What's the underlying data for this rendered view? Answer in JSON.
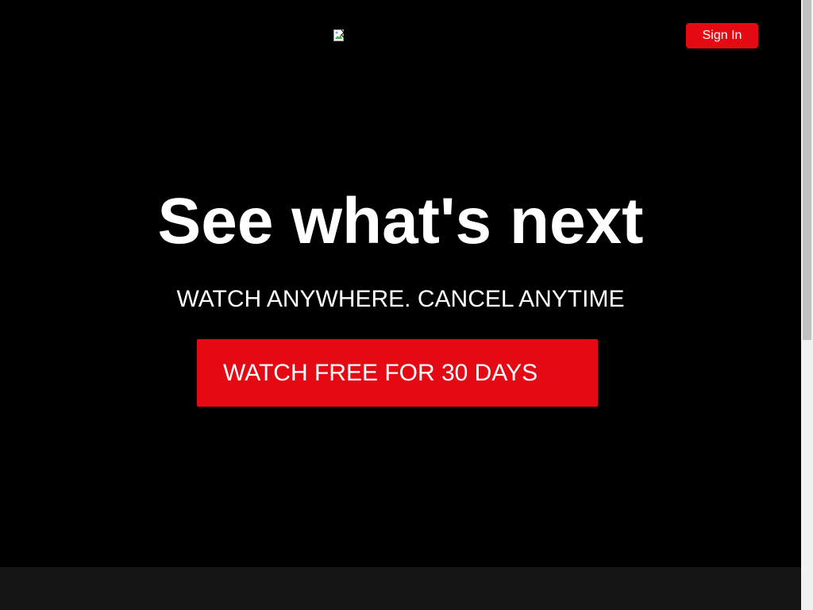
{
  "header": {
    "logo_icon": "broken-image-icon",
    "sign_in_label": "Sign In"
  },
  "hero": {
    "title": "See what's next",
    "subtitle": "WATCH ANYWHERE. CANCEL ANYTIME",
    "cta_label": "WATCH FREE FOR 30 DAYS"
  },
  "colors": {
    "background": "#000000",
    "accent": "#e50914",
    "text": "#ffffff",
    "footer_band": "#151515"
  }
}
